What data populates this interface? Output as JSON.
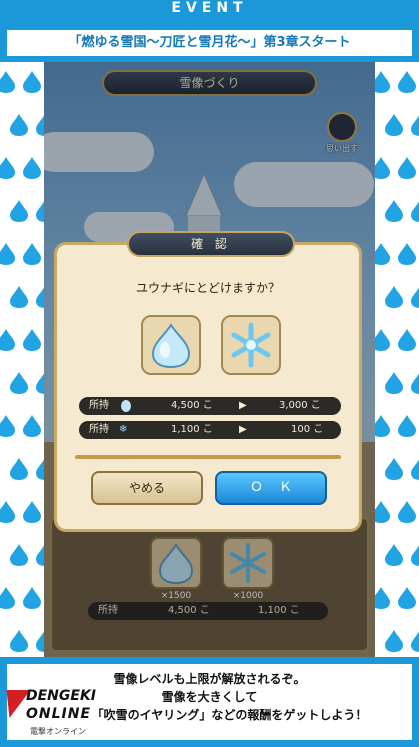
{
  "banner": {
    "event_label": "EVENT",
    "headline": "「燃ゆる雪国〜刀匠と雪月花〜」第3章スタート"
  },
  "game_screen": {
    "title": "雪像づくり",
    "memory_label": "思い出す",
    "items": [
      {
        "icon": "water-drop-icon",
        "count": "×1500"
      },
      {
        "icon": "snowflake-icon",
        "count": "×1000"
      }
    ],
    "owned_label": "所持",
    "owned_drops": "4,500 こ",
    "owned_snow": "1,100 こ"
  },
  "dialog": {
    "title": "確 認",
    "question": "ユウナギにとどけますか？",
    "rows": [
      {
        "label": "所持",
        "icon": "water-drop-icon",
        "before": "4,500 こ",
        "after": "3,000 こ"
      },
      {
        "label": "所持",
        "icon": "snowflake-icon",
        "before": "1,100 こ",
        "after": "100 こ"
      }
    ],
    "cancel_label": "やめる",
    "ok_label": "ＯＫ"
  },
  "footer": {
    "lines": [
      "雪像レベルも上限が解放されるぞ。",
      "雪像を大きくして",
      "「吹雪のイヤリング」などの報酬をゲットしよう！"
    ]
  },
  "logo": {
    "line1": "DENGEKI",
    "line2": "ONLINE",
    "line3": "電撃オンライン"
  },
  "colors": {
    "brand_blue": "#1a98d8",
    "ok_blue": "#1b87d7",
    "gold": "#c8a865"
  }
}
